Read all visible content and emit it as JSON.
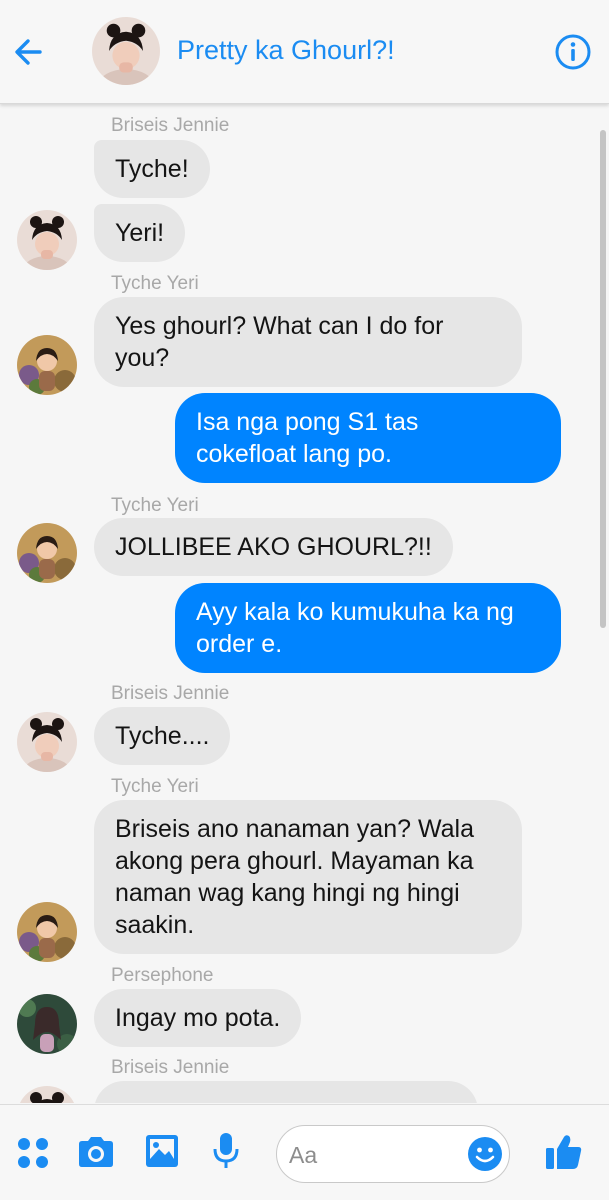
{
  "header": {
    "title": "Pretty ka Ghourl?!"
  },
  "messages": [
    {
      "sender": "Briseis Jennie",
      "bubbles": [
        "Tyche!",
        "Yeri!"
      ]
    },
    {
      "sender": "Tyche Yeri",
      "text_line1": "Yes ghourl? What can I do for",
      "text_line2": "you?"
    },
    {
      "outgoing_line1": "Isa nga pong S1 tas",
      "outgoing_line2": "cokefloat lang po."
    },
    {
      "sender": "Tyche Yeri",
      "text": "JOLLIBEE AKO GHOURL?!!"
    },
    {
      "outgoing_line1": "Ayy kala ko kumukuha ka ng",
      "outgoing_line2": "order e."
    },
    {
      "sender": "Briseis Jennie",
      "text": "Tyche...."
    },
    {
      "sender": "Tyche Yeri",
      "lines": [
        "Briseis ano nanaman yan? Wala",
        "akong pera ghourl. Mayaman ka",
        "naman wag kang hingi ng hingi",
        "saakin."
      ]
    },
    {
      "sender": "Persephone",
      "text": "Ingay mo pota."
    },
    {
      "sender": "Briseis Jennie"
    }
  ],
  "composer": {
    "placeholder": "Aa"
  },
  "colors": {
    "accent": "#0084ff",
    "title_blue": "#1b8cf2",
    "incoming_bubble": "#e6e6e6"
  },
  "icons": [
    "back-arrow-icon",
    "info-icon",
    "apps-icon",
    "camera-icon",
    "image-icon",
    "microphone-icon",
    "emoji-icon",
    "thumbs-up-icon"
  ]
}
